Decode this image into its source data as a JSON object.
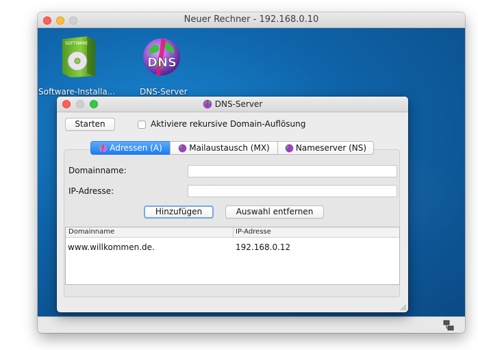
{
  "outer_window": {
    "title": "Neuer Rechner - 192.168.0.10"
  },
  "desktop": {
    "icons": [
      {
        "label": "Software-Installa...",
        "logo_text": "SOFTWARE",
        "icon": "software-installer-icon"
      },
      {
        "label": "DNS-Server",
        "logo_text": "DNS",
        "icon": "dns-globe-icon"
      }
    ]
  },
  "dns_window": {
    "title": "DNS-Server",
    "start_button": "Starten",
    "recursive_checkbox": {
      "label": "Aktiviere rekursive Domain-Auflösung",
      "checked": false
    },
    "tabs": [
      {
        "label": "Adressen (A)",
        "active": true
      },
      {
        "label": "Mailaustausch (MX)",
        "active": false
      },
      {
        "label": "Nameserver (NS)",
        "active": false
      }
    ],
    "form": {
      "domain_label": "Domainname:",
      "domain_value": "",
      "ip_label": "IP-Adresse:",
      "ip_value": ""
    },
    "add_button": "Hinzufügen",
    "remove_button": "Auswahl entfernen",
    "table": {
      "columns": [
        "Domainname",
        "IP-Adresse"
      ],
      "rows": [
        {
          "domain": "www.willkommen.de.",
          "ip": "192.168.0.12"
        }
      ]
    }
  },
  "colors": {
    "desktop_blue": "#0f63a8",
    "active_tab_blue": "#1c7cf4",
    "traffic_red": "#fc605c",
    "traffic_yellow": "#fdbc40",
    "traffic_green": "#34c84a"
  }
}
